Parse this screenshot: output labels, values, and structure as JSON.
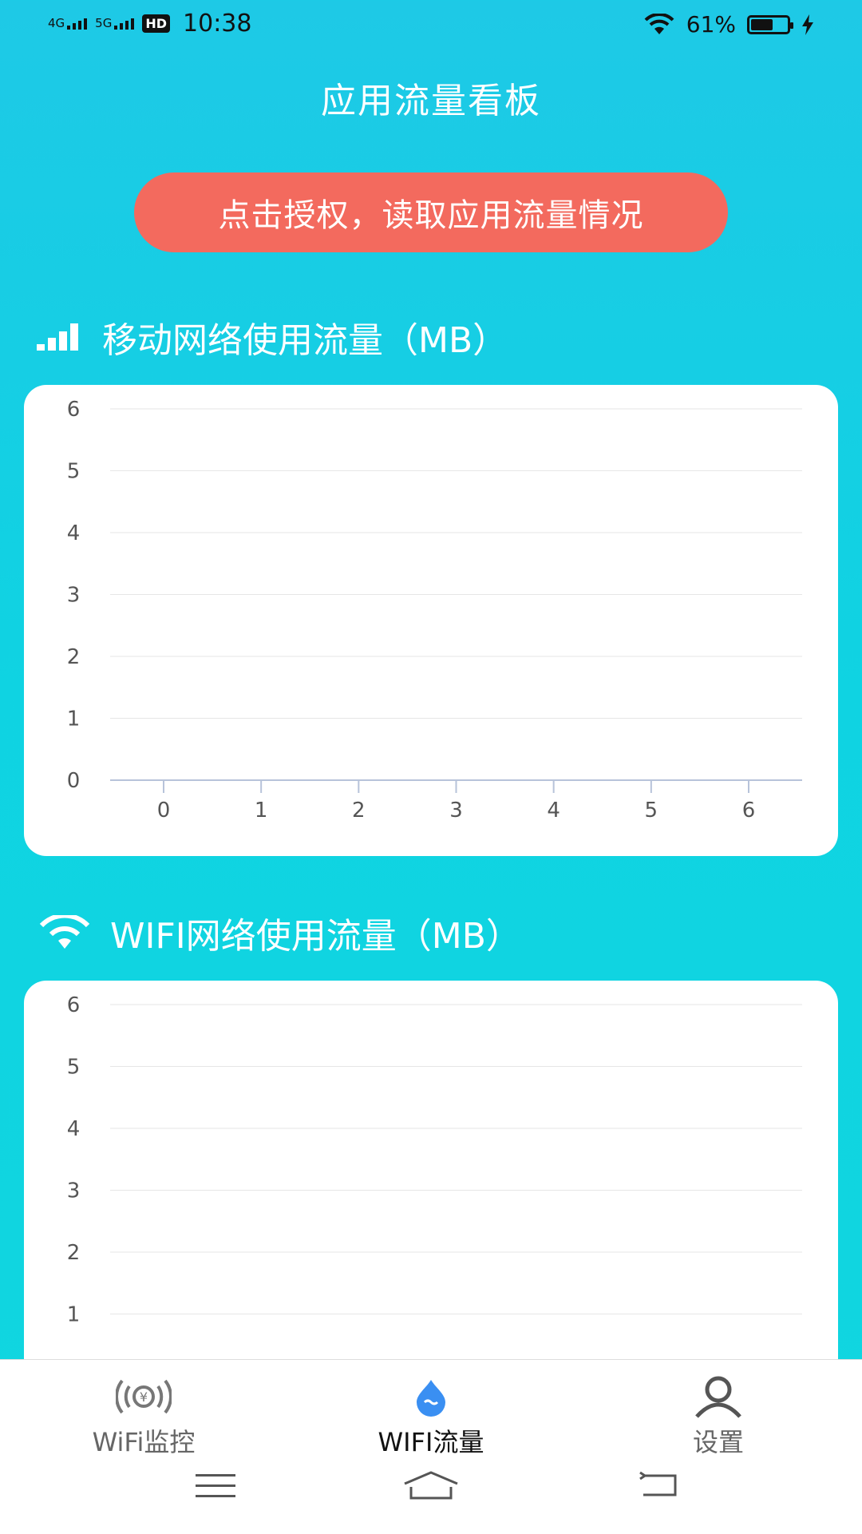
{
  "status_bar": {
    "network1": "4G",
    "network2": "5G",
    "hd_badge": "HD",
    "time": "10:38",
    "battery_percent": "61%",
    "battery_level": 0.61
  },
  "header": {
    "title": "应用流量看板"
  },
  "auth_button": {
    "label": "点击授权，读取应用流量情况"
  },
  "sections": {
    "mobile": {
      "title": "移动网络使用流量（MB）"
    },
    "wifi": {
      "title": "WIFI网络使用流量（MB）"
    }
  },
  "chart_data": [
    {
      "type": "line",
      "x": [
        0,
        1,
        2,
        3,
        4,
        5,
        6
      ],
      "y_ticks": [
        0,
        1,
        2,
        3,
        4,
        5,
        6
      ],
      "x_tick_labels": [
        "0",
        "1",
        "2",
        "3",
        "4",
        "5",
        "6"
      ],
      "y_tick_labels": [
        "0",
        "1",
        "2",
        "3",
        "4",
        "5",
        "6"
      ],
      "ylim": [
        0,
        6
      ],
      "xlim": [
        0,
        6
      ],
      "grid": true,
      "series": []
    },
    {
      "type": "line",
      "y_ticks": [
        1,
        2,
        3,
        4,
        5,
        6
      ],
      "y_tick_labels": [
        "1",
        "2",
        "3",
        "4",
        "5",
        "6"
      ],
      "ylim": [
        0,
        6
      ],
      "grid": true,
      "series": []
    }
  ],
  "bottom_nav": {
    "items": [
      {
        "label": "WiFi监控",
        "icon": "wifi-signal-yen-icon"
      },
      {
        "label": "WIFI流量",
        "icon": "water-drop-icon"
      },
      {
        "label": "设置",
        "icon": "user-icon"
      }
    ]
  },
  "colors": {
    "background_top": "#1ec9e6",
    "background_bottom": "#11d6df",
    "button": "#f36a5e",
    "active_icon": "#3a8ff2"
  }
}
